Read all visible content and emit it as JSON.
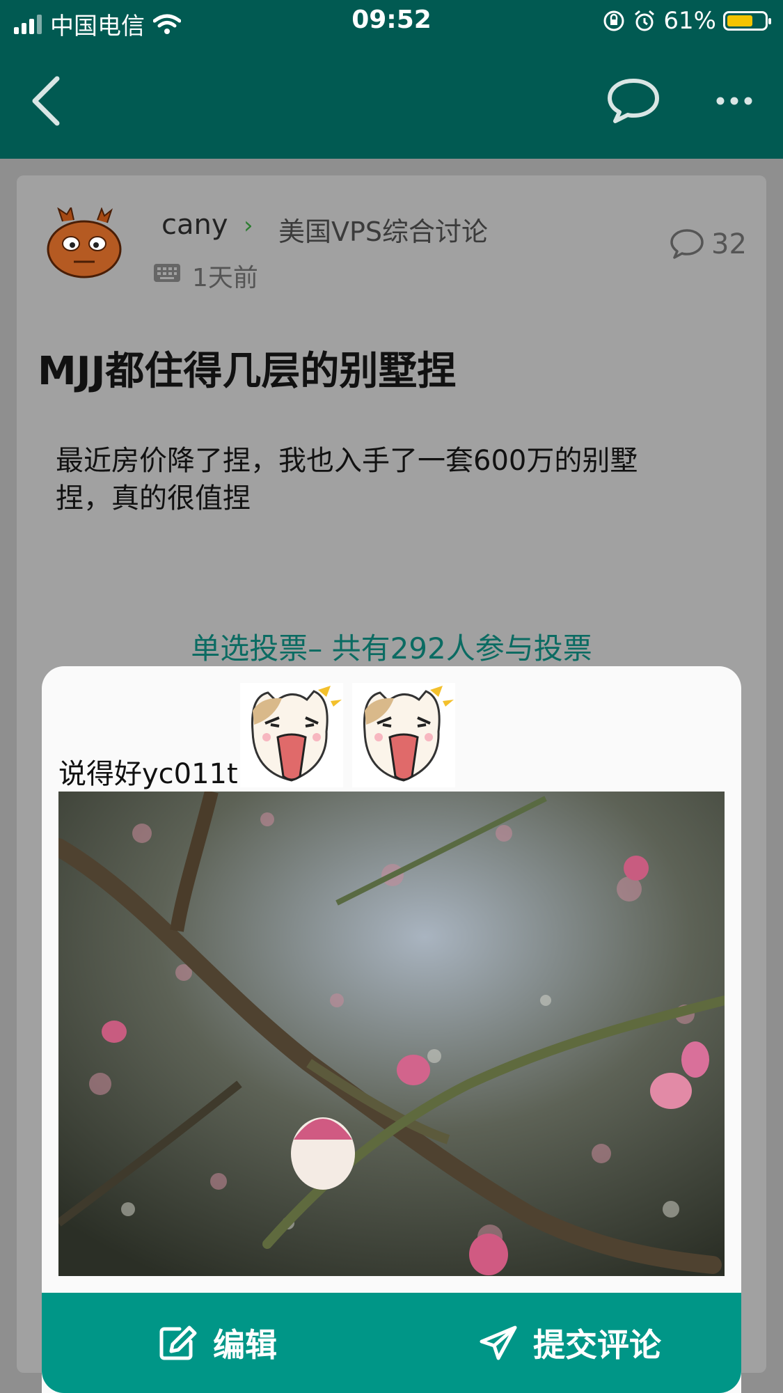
{
  "status_bar": {
    "carrier": "中国电信",
    "time": "09:52",
    "battery": "61%",
    "battery_level": 0.61,
    "icons": [
      "signal-icon",
      "wifi-icon",
      "orientation-lock-icon",
      "alarm-icon",
      "battery-icon"
    ]
  },
  "nav": {
    "icons": [
      "back-icon",
      "chat-icon",
      "more-icon"
    ]
  },
  "post": {
    "author": "cany",
    "forum": "美国VPS综合讨论",
    "time": "1天前",
    "comment_count": "32",
    "title": "MJJ都住得几层的别墅捏",
    "body_line1": "最近房价降了捏，我也入手了一套600万的别墅",
    "body_line2": "捏，真的很值捏",
    "vote_header": "单选投票– 共有292人参与投票"
  },
  "comment": {
    "text": "说得好yc011t",
    "stickers": [
      "shouting-cat-sticker",
      "shouting-cat-sticker"
    ],
    "photo": "plum-blossom-photo"
  },
  "actions": {
    "edit_label": "编辑",
    "submit_label": "提交评论"
  },
  "colors": {
    "topbar": "#015a52",
    "accent": "#009687",
    "vote_text": "#0b6b62",
    "battery": "#f5c400"
  }
}
